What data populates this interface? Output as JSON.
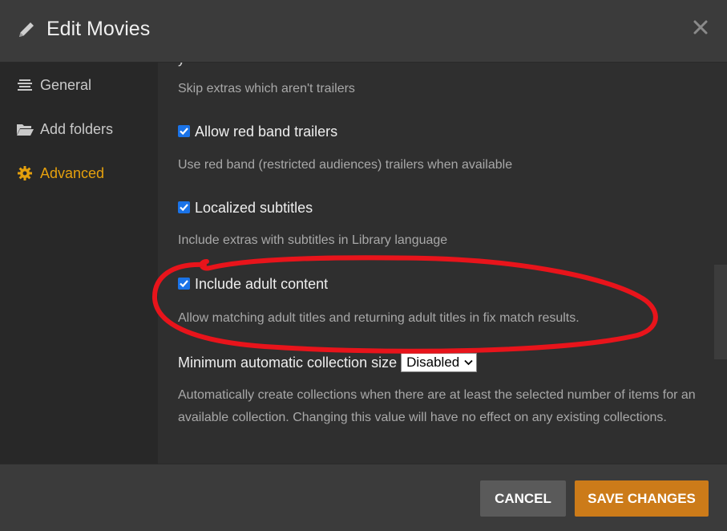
{
  "dialog": {
    "title": "Edit Movies"
  },
  "sidebar": {
    "items": [
      {
        "label": "General",
        "icon": "list-icon"
      },
      {
        "label": "Add folders",
        "icon": "folder-icon"
      },
      {
        "label": "Advanced",
        "icon": "gear-icon",
        "active": true
      }
    ]
  },
  "settings": {
    "cut_label": "y",
    "skip_extras_desc": "Skip extras which aren't trailers",
    "red_band": {
      "label": "Allow red band trailers",
      "checked": true,
      "desc": "Use red band (restricted audiences) trailers when available"
    },
    "localized_subtitles": {
      "label": "Localized subtitles",
      "checked": true,
      "desc": "Include extras with subtitles in Library language"
    },
    "adult_content": {
      "label": "Include adult content",
      "checked": true,
      "desc": "Allow matching adult titles and returning adult titles in fix match results."
    },
    "collection_size": {
      "label": "Minimum automatic collection size",
      "value": "Disabled",
      "desc": "Automatically create collections when there are at least the selected number of items for an available collection. Changing this value will have no effect on any existing collections."
    }
  },
  "footer": {
    "cancel_label": "CANCEL",
    "save_label": "SAVE CHANGES"
  },
  "colors": {
    "accent": "#e5a00d",
    "save_button": "#cc7b19",
    "checkbox": "#1a73e8",
    "annotation": "#e8141b"
  }
}
